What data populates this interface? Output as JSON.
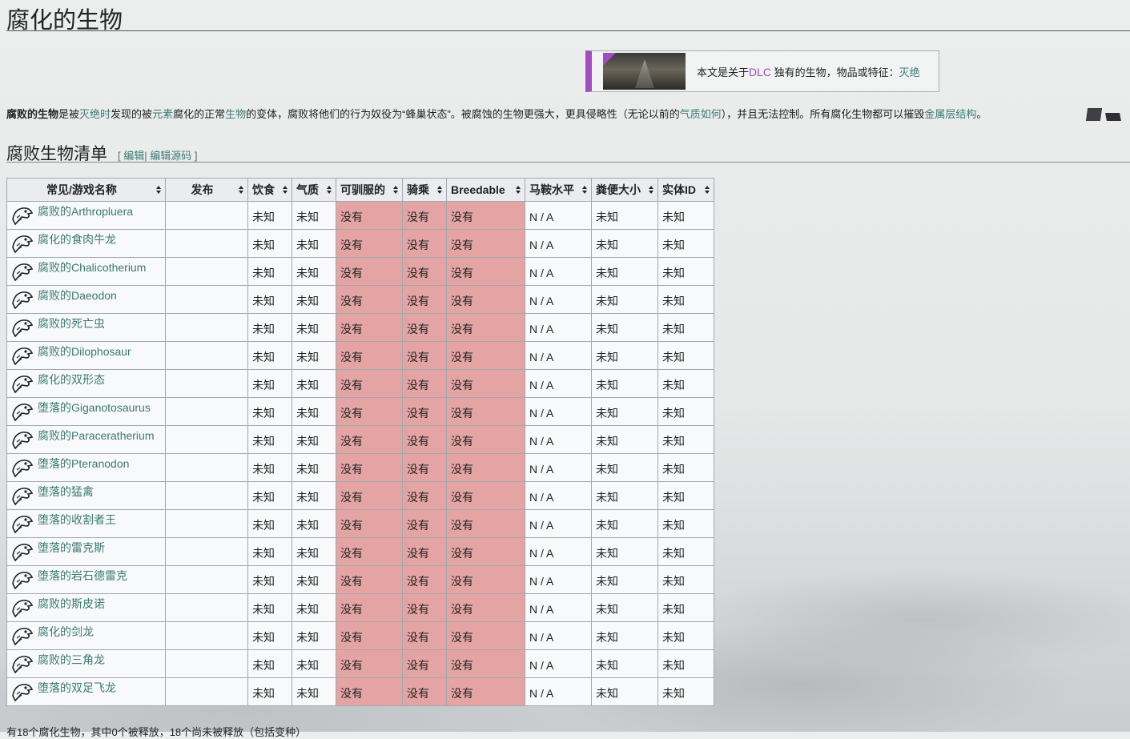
{
  "page": {
    "title": "腐化的生物"
  },
  "dlc_notice": {
    "prefix": "本文是关于",
    "dlc": "DLC",
    "middle": "独有的生物，物品或特征：",
    "link": "灭绝"
  },
  "intro": {
    "bold": "腐败的生物",
    "t1": "是被",
    "l1": "灭绝时",
    "t2": "发现的被",
    "l2": "元素",
    "t3": "腐化的正常",
    "l3": "生物",
    "t4": "的变体，腐败将他们的行为奴役为“蜂巢状态”。被腐蚀的生物更强大，更具侵略性（无论以前的",
    "l4": "气质如何",
    "t5": "），并且无法控制。所有腐化生物都可以摧毁",
    "l5": "金属层结构",
    "t6": "。"
  },
  "section": {
    "title": "腐败生物清单",
    "open": "[",
    "edit": "编辑",
    "sep": "|",
    "edit_source": "编辑源码",
    "close": "]"
  },
  "table": {
    "headers": [
      "常见/游戏名称",
      "发布",
      "饮食",
      "气质",
      "可驯服的",
      "骑乘",
      "Breedable",
      "马鞍水平",
      "粪便大小",
      "实体ID"
    ],
    "rows": [
      {
        "name": "腐败的Arthropluera",
        "release": "",
        "diet": "未知",
        "temperament": "未知",
        "tamable": "没有",
        "rideable": "没有",
        "breedable": "没有",
        "saddle": "N / A",
        "feces": "未知",
        "entity": "未知"
      },
      {
        "name": "腐化的食肉牛龙",
        "release": "",
        "diet": "未知",
        "temperament": "未知",
        "tamable": "没有",
        "rideable": "没有",
        "breedable": "没有",
        "saddle": "N / A",
        "feces": "未知",
        "entity": "未知"
      },
      {
        "name": "腐败的Chalicotherium",
        "release": "",
        "diet": "未知",
        "temperament": "未知",
        "tamable": "没有",
        "rideable": "没有",
        "breedable": "没有",
        "saddle": "N / A",
        "feces": "未知",
        "entity": "未知"
      },
      {
        "name": "腐败的Daeodon",
        "release": "",
        "diet": "未知",
        "temperament": "未知",
        "tamable": "没有",
        "rideable": "没有",
        "breedable": "没有",
        "saddle": "N / A",
        "feces": "未知",
        "entity": "未知"
      },
      {
        "name": "腐败的死亡虫",
        "release": "",
        "diet": "未知",
        "temperament": "未知",
        "tamable": "没有",
        "rideable": "没有",
        "breedable": "没有",
        "saddle": "N / A",
        "feces": "未知",
        "entity": "未知"
      },
      {
        "name": "腐败的Dilophosaur",
        "release": "",
        "diet": "未知",
        "temperament": "未知",
        "tamable": "没有",
        "rideable": "没有",
        "breedable": "没有",
        "saddle": "N / A",
        "feces": "未知",
        "entity": "未知"
      },
      {
        "name": "腐化的双形态",
        "release": "",
        "diet": "未知",
        "temperament": "未知",
        "tamable": "没有",
        "rideable": "没有",
        "breedable": "没有",
        "saddle": "N / A",
        "feces": "未知",
        "entity": "未知"
      },
      {
        "name": "堕落的Giganotosaurus",
        "release": "",
        "diet": "未知",
        "temperament": "未知",
        "tamable": "没有",
        "rideable": "没有",
        "breedable": "没有",
        "saddle": "N / A",
        "feces": "未知",
        "entity": "未知"
      },
      {
        "name": "腐败的Paraceratherium",
        "release": "",
        "diet": "未知",
        "temperament": "未知",
        "tamable": "没有",
        "rideable": "没有",
        "breedable": "没有",
        "saddle": "N / A",
        "feces": "未知",
        "entity": "未知"
      },
      {
        "name": "堕落的Pteranodon",
        "release": "",
        "diet": "未知",
        "temperament": "未知",
        "tamable": "没有",
        "rideable": "没有",
        "breedable": "没有",
        "saddle": "N / A",
        "feces": "未知",
        "entity": "未知"
      },
      {
        "name": "堕落的猛禽",
        "release": "",
        "diet": "未知",
        "temperament": "未知",
        "tamable": "没有",
        "rideable": "没有",
        "breedable": "没有",
        "saddle": "N / A",
        "feces": "未知",
        "entity": "未知"
      },
      {
        "name": "堕落的收割者王",
        "release": "",
        "diet": "未知",
        "temperament": "未知",
        "tamable": "没有",
        "rideable": "没有",
        "breedable": "没有",
        "saddle": "N / A",
        "feces": "未知",
        "entity": "未知"
      },
      {
        "name": "堕落的雷克斯",
        "release": "",
        "diet": "未知",
        "temperament": "未知",
        "tamable": "没有",
        "rideable": "没有",
        "breedable": "没有",
        "saddle": "N / A",
        "feces": "未知",
        "entity": "未知"
      },
      {
        "name": "堕落的岩石德雷克",
        "release": "",
        "diet": "未知",
        "temperament": "未知",
        "tamable": "没有",
        "rideable": "没有",
        "breedable": "没有",
        "saddle": "N / A",
        "feces": "未知",
        "entity": "未知"
      },
      {
        "name": "腐败的斯皮诺",
        "release": "",
        "diet": "未知",
        "temperament": "未知",
        "tamable": "没有",
        "rideable": "没有",
        "breedable": "没有",
        "saddle": "N / A",
        "feces": "未知",
        "entity": "未知"
      },
      {
        "name": "腐化的剑龙",
        "release": "",
        "diet": "未知",
        "temperament": "未知",
        "tamable": "没有",
        "rideable": "没有",
        "breedable": "没有",
        "saddle": "N / A",
        "feces": "未知",
        "entity": "未知"
      },
      {
        "name": "腐败的三角龙",
        "release": "",
        "diet": "未知",
        "temperament": "未知",
        "tamable": "没有",
        "rideable": "没有",
        "breedable": "没有",
        "saddle": "N / A",
        "feces": "未知",
        "entity": "未知"
      },
      {
        "name": "堕落的双足飞龙",
        "release": "",
        "diet": "未知",
        "temperament": "未知",
        "tamable": "没有",
        "rideable": "没有",
        "breedable": "没有",
        "saddle": "N / A",
        "feces": "未知",
        "entity": "未知"
      }
    ]
  },
  "footer": {
    "text": "有18个腐化生物，其中0个被释放，18个尚未被释放（包括变种）"
  }
}
